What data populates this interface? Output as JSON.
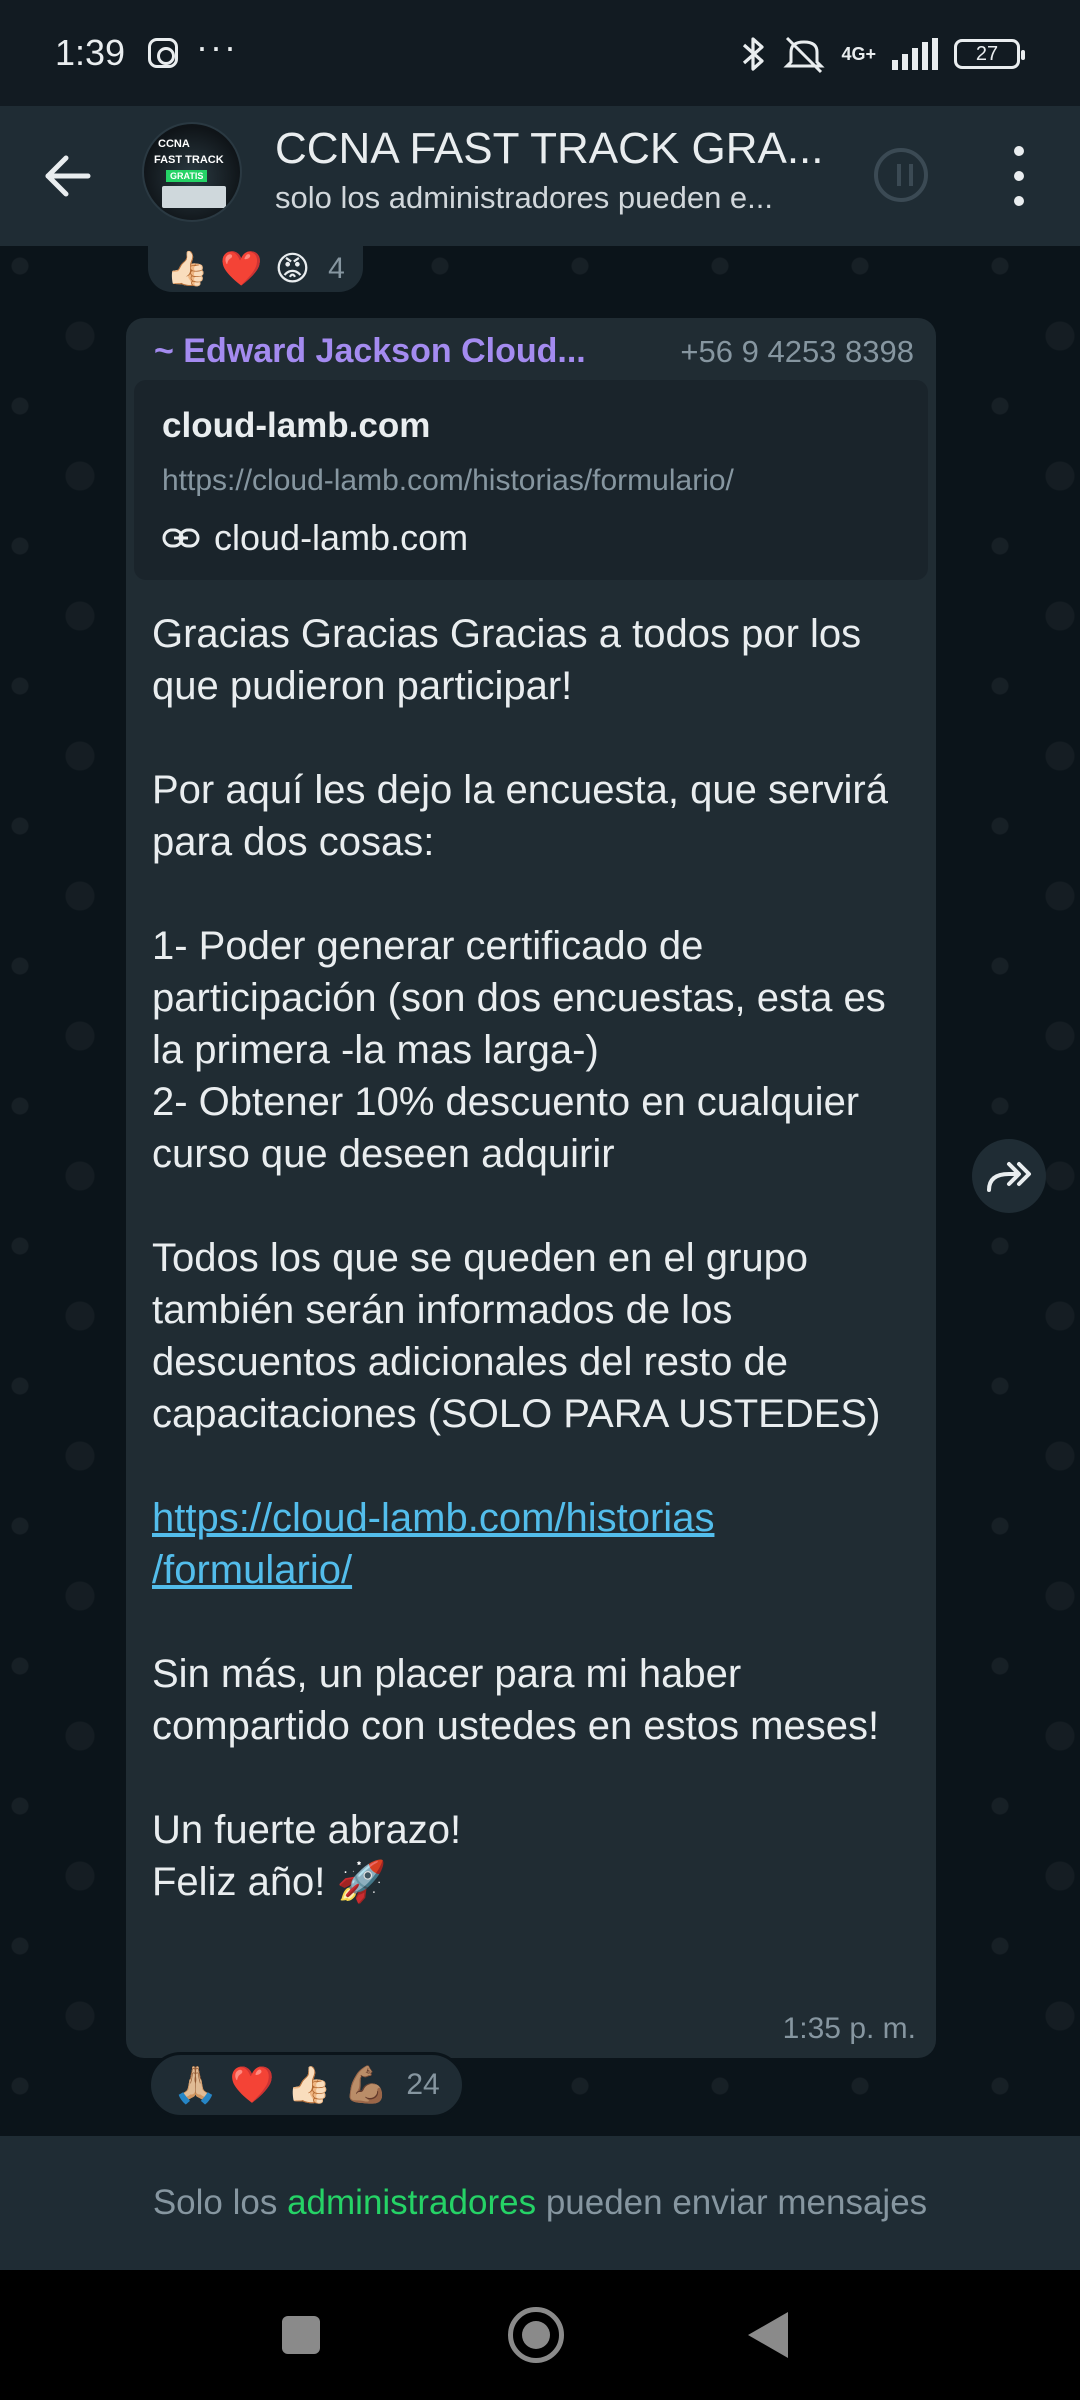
{
  "status_bar": {
    "time": "1:39",
    "extra_dots": "···",
    "network": "4G+",
    "battery": "27",
    "icons": [
      "instagram-icon",
      "bluetooth-icon",
      "mute-icon",
      "signal-icon",
      "battery-icon"
    ]
  },
  "header": {
    "title": "CCNA FAST TRACK GRA...",
    "subtitle": "solo los administradores pueden e...",
    "avatar_text": [
      "CCNA",
      "FAST TRACK",
      "GRATIS"
    ]
  },
  "messages": {
    "top_reactions": {
      "emojis": [
        "👍🏻",
        "❤️",
        "😡"
      ],
      "count": "4"
    },
    "main": {
      "sender": "~ Edward Jackson Cloud...",
      "phone": "+56 9 4253 8398",
      "preview": {
        "title": "cloud-lamb.com",
        "url": "https://cloud-lamb.com/historias/formulario/",
        "domain": "cloud-lamb.com"
      },
      "p1": "Gracias Gracias Gracias a todos por los que pudieron participar!",
      "p2": "Por aquí les dejo la encuesta, que servirá para dos cosas:",
      "p3_line1": "1- Poder generar certificado de participación (son dos encuestas, esta es la primera -la mas larga-)",
      "p3_line2": "2- Obtener 10% descuento en cualquier curso que deseen adquirir",
      "p4": "Todos los que se queden en el grupo también serán informados de los descuentos adicionales del resto de capacitaciones (SOLO PARA USTEDES)",
      "link_line1": "https://cloud-lamb.com/historias",
      "link_line2": "/formulario/",
      "p6": "Sin más, un placer para mi haber compartido con ustedes en estos meses!",
      "p7_line1": "Un fuerte abrazo!",
      "p7_line2": "Feliz año!",
      "p7_emoji": "🚀",
      "time": "1:35 p. m."
    },
    "bottom_reactions": {
      "emojis": [
        "🙏🏼",
        "❤️",
        "👍🏻",
        "💪🏽"
      ],
      "count": "24"
    }
  },
  "footer": {
    "prefix": "Solo los",
    "highlight": "administradores",
    "suffix": "pueden enviar mensajes"
  },
  "colors": {
    "background": "#0b141a",
    "bubble": "#202c33",
    "header": "#1f2c34",
    "accent_green": "#25d366",
    "link_blue": "#53bdeb",
    "sender_purple": "#a48bf0"
  }
}
